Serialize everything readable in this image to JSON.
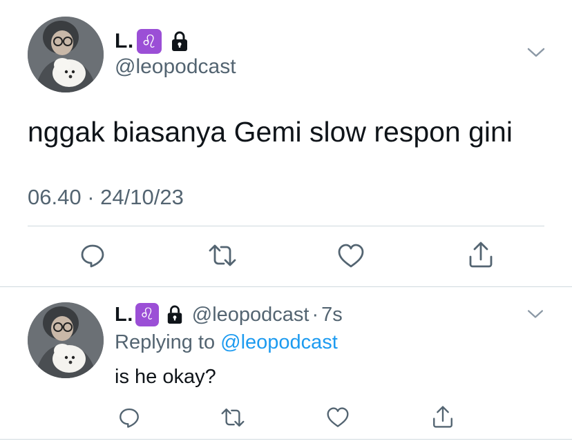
{
  "main_tweet": {
    "display_name": "L.",
    "zodiac_symbol": "♌",
    "handle": "@leopodcast",
    "text": "nggak biasanya Gemi slow respon gini",
    "time": "06.40",
    "separator": "·",
    "date": "24/10/23",
    "icons": {
      "avatar": "avatar-photo-icon",
      "lock": "lock-icon",
      "menu": "chevron-down-icon",
      "reply": "reply-bubble-icon",
      "retweet": "retweet-icon",
      "like": "heart-icon",
      "share": "share-upload-icon"
    }
  },
  "reply_tweet": {
    "display_name": "L.",
    "zodiac_symbol": "♌",
    "handle": "@leopodcast",
    "separator": "·",
    "time_ago": "7s",
    "replying_prefix": "Replying to",
    "replying_mention": "@leopodcast",
    "text": "is he okay?"
  },
  "colors": {
    "text_primary": "#0f1419",
    "text_secondary": "#536471",
    "link": "#1d9bf0",
    "badge": "#9b4fd6",
    "divider": "#cfd9de",
    "icon": "#536471"
  }
}
